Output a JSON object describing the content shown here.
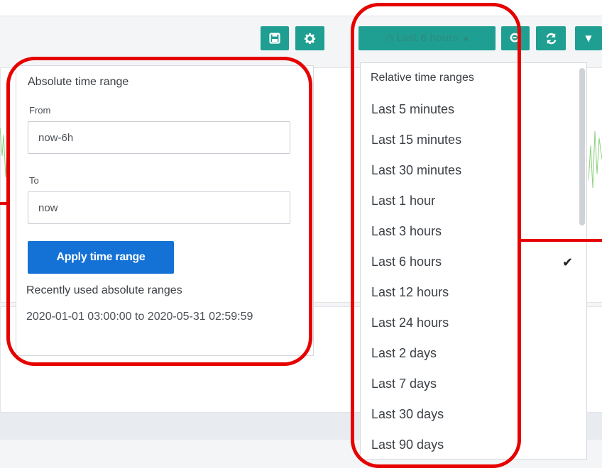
{
  "toolbar": {
    "save_icon": "save-icon",
    "settings_icon": "gear-icon",
    "time_picker_label": "Last 6 hours",
    "zoom_icon": "zoom-out-icon",
    "refresh_icon": "refresh-icon",
    "refresh_dropdown_icon": "caret-down-icon"
  },
  "absolute_range": {
    "title": "Absolute time range",
    "from_label": "From",
    "from_value": "now-6h",
    "to_label": "To",
    "to_value": "now",
    "apply_label": "Apply time range",
    "recent_title": "Recently used absolute ranges",
    "recent_items": [
      "2020-01-01 03:00:00 to 2020-05-31 02:59:59"
    ]
  },
  "relative_ranges": {
    "title": "Relative time ranges",
    "items": [
      "Last 5 minutes",
      "Last 15 minutes",
      "Last 30 minutes",
      "Last 1 hour",
      "Last 3 hours",
      "Last 6 hours",
      "Last 12 hours",
      "Last 24 hours",
      "Last 2 days",
      "Last 7 days",
      "Last 30 days",
      "Last 90 days"
    ],
    "selected": "Last 6 hours"
  },
  "colors": {
    "toolbar_button": "#1f9f91",
    "apply_button": "#1471d6",
    "annotation": "#e60000"
  }
}
